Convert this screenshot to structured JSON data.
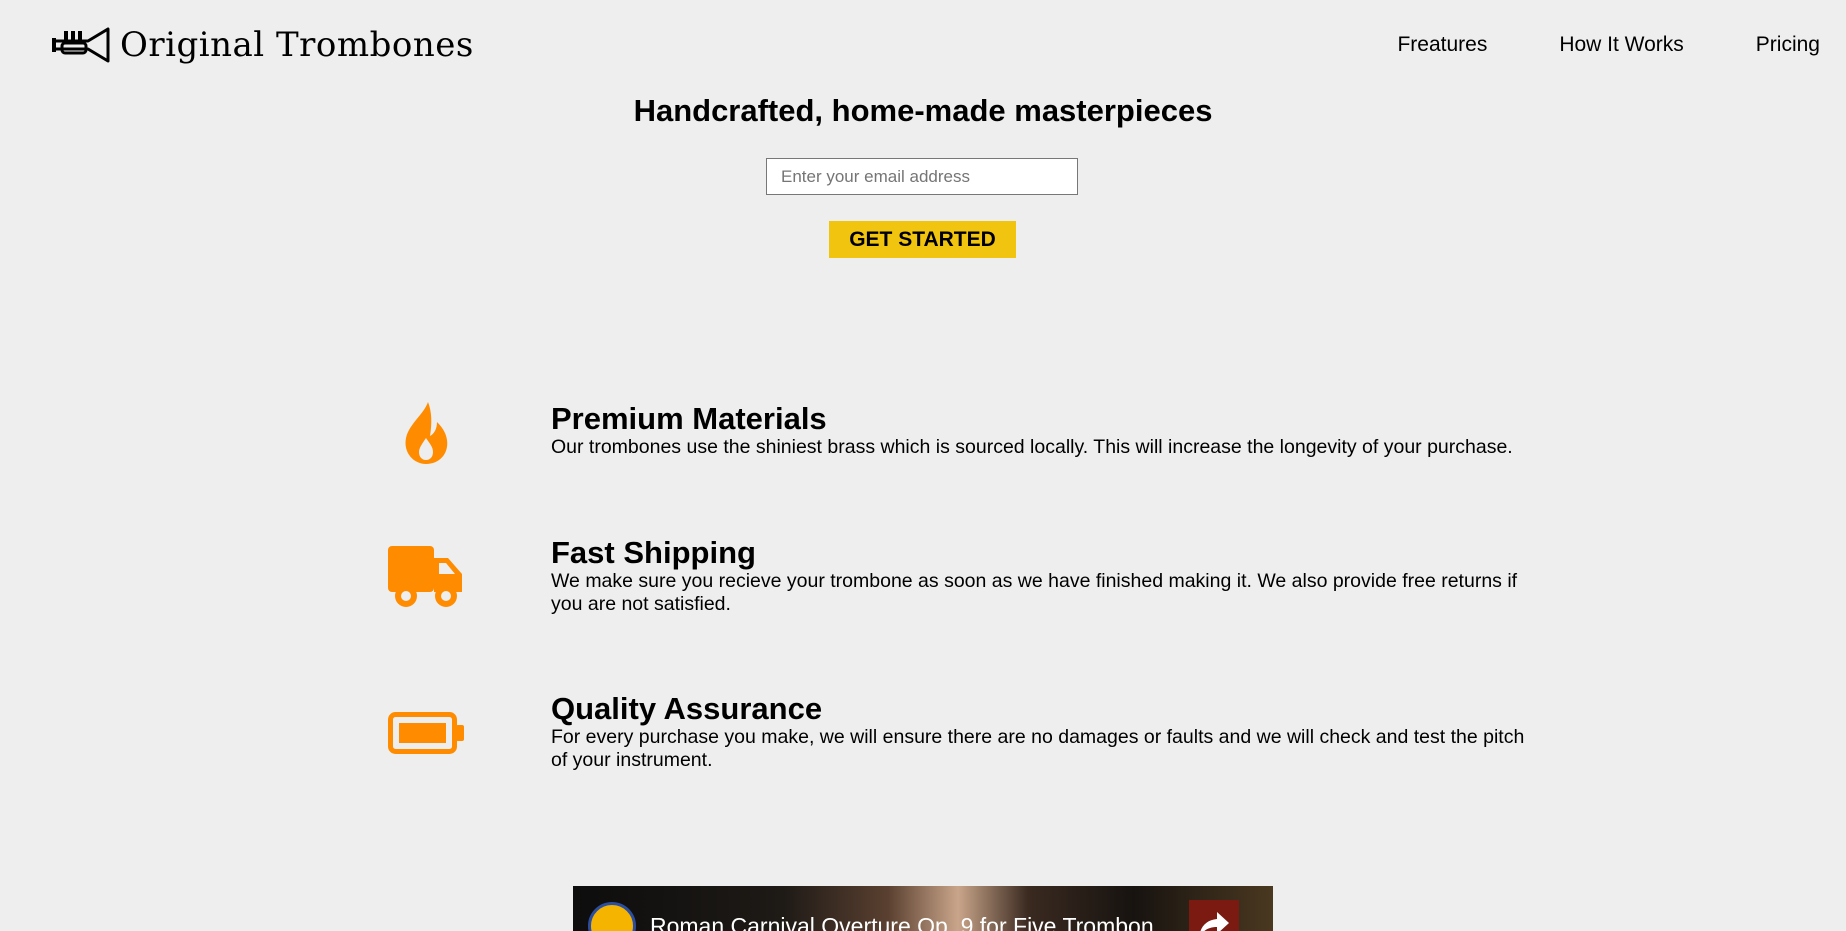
{
  "header": {
    "brand": "Original Trombones",
    "logo_icon": "trumpet-icon",
    "nav": [
      {
        "label": "Freatures"
      },
      {
        "label": "How It Works"
      },
      {
        "label": "Pricing"
      }
    ]
  },
  "hero": {
    "title": "Handcrafted, home-made masterpieces",
    "email_placeholder": "Enter your email address",
    "cta_label": "GET STARTED"
  },
  "features": [
    {
      "icon": "fire-icon",
      "title": "Premium Materials",
      "text": "Our trombones use the shiniest brass which is sourced locally. This will increase the longevity of your purchase."
    },
    {
      "icon": "truck-icon",
      "title": "Fast Shipping",
      "text": "We make sure you recieve your trombone as soon as we have finished making it. We also provide free returns if you are not satisfied."
    },
    {
      "icon": "battery-full-icon",
      "title": "Quality Assurance",
      "text": "For every purchase you make, we will ensure there are no damages or faults and we will check and test the pitch of your instrument."
    }
  ],
  "video": {
    "title": "Roman Carnival Overture Op. 9 for Five Trombon..."
  },
  "colors": {
    "background": "#eeeeee",
    "accent": "#ff8c00",
    "cta": "#f1c40f"
  }
}
